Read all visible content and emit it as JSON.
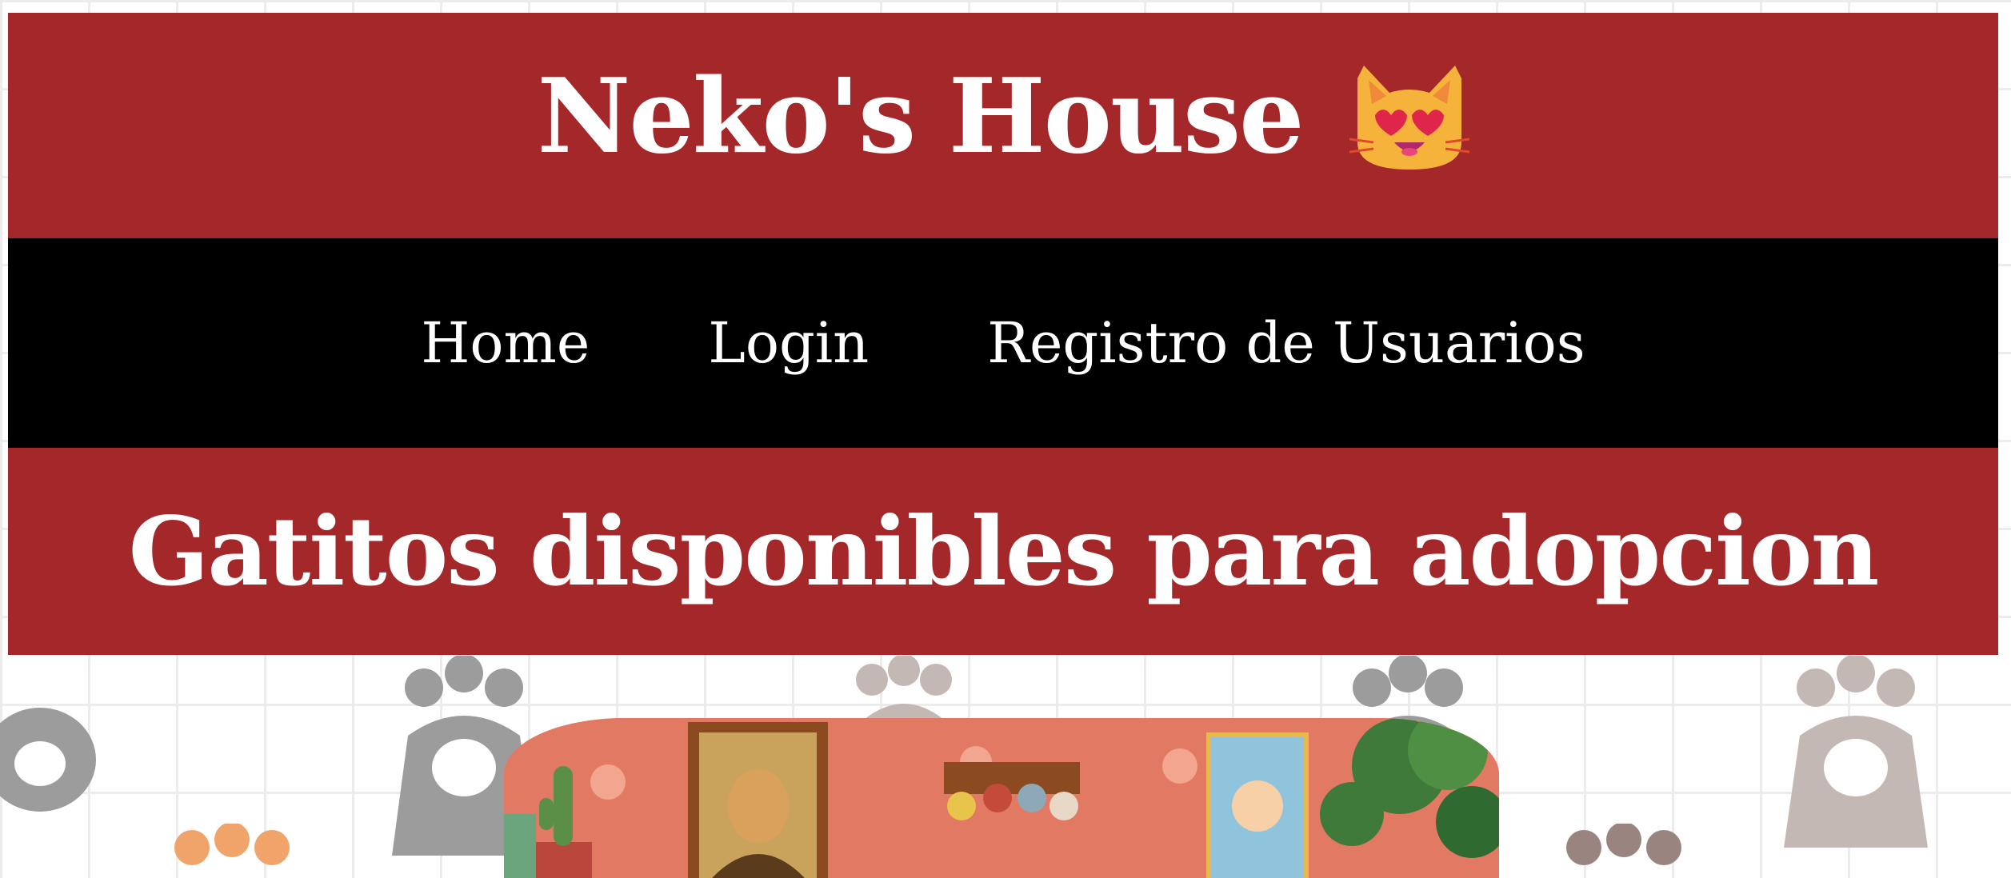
{
  "header": {
    "title": "Neko's House",
    "emoji": "smiling-cat-heart-eyes-icon"
  },
  "nav": {
    "items": [
      {
        "label": "Home"
      },
      {
        "label": "Login"
      },
      {
        "label": "Registro de Usuarios"
      }
    ]
  },
  "main": {
    "heading": "Gatitos disponibles para adopcion"
  },
  "colors": {
    "banner": "#a4282a",
    "nav": "#000000",
    "text": "#ffffff",
    "image_wall": "#e27a63"
  }
}
